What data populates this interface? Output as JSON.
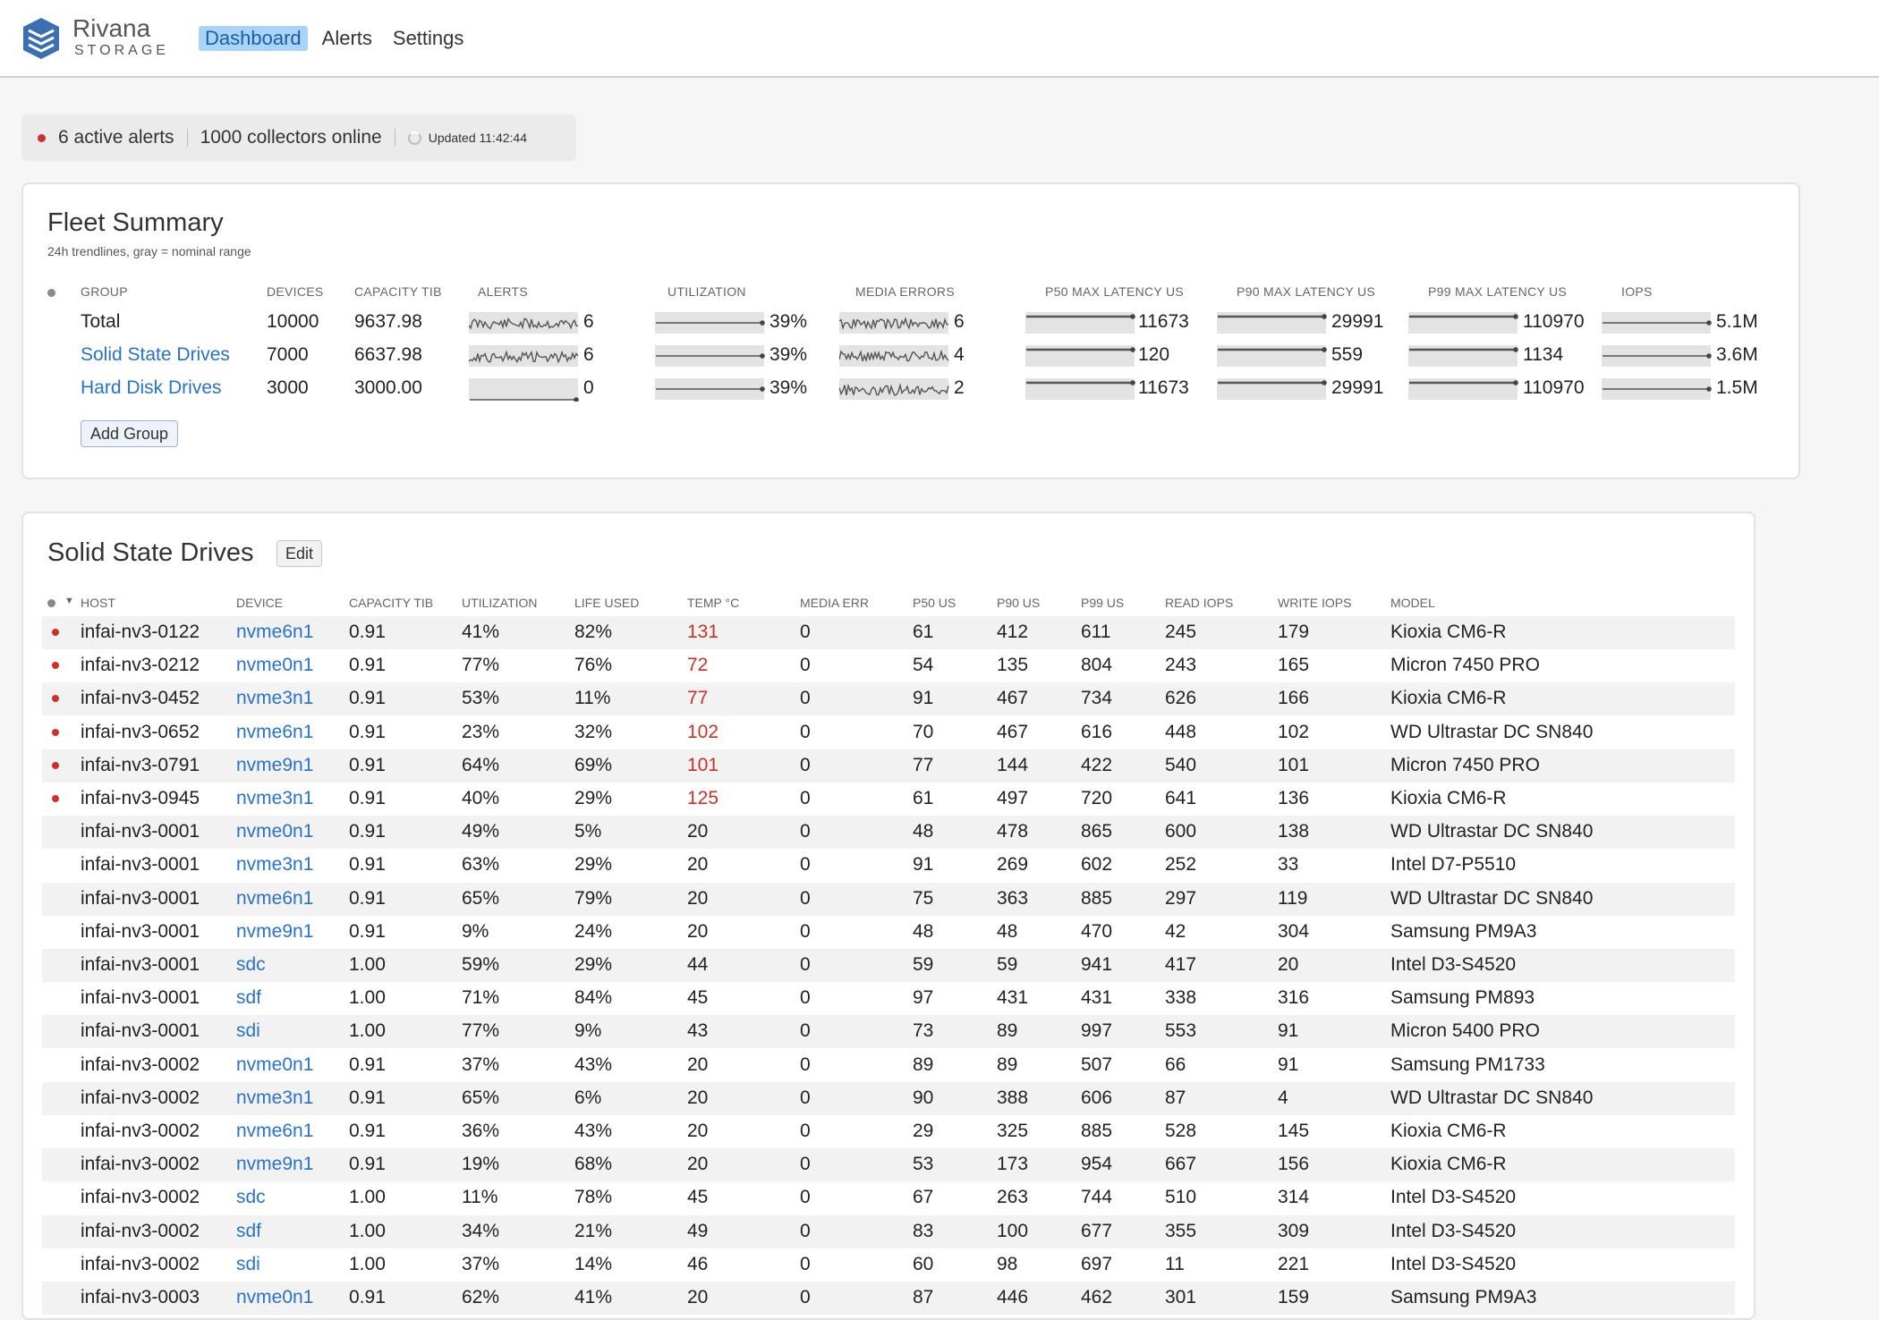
{
  "brand": {
    "name": "Rivana",
    "sub": "STORAGE"
  },
  "nav": [
    {
      "label": "Dashboard",
      "active": true
    },
    {
      "label": "Alerts"
    },
    {
      "label": "Settings"
    }
  ],
  "status": {
    "alerts": "6 active alerts",
    "collectors": "1000 collectors online",
    "updated": "Updated 11:42:44"
  },
  "fleet": {
    "title": "Fleet Summary",
    "subtitle": "24h trendlines, gray = nominal range",
    "headers": [
      "GROUP",
      "DEVICES",
      "CAPACITY TIB",
      "ALERTS",
      "UTILIZATION",
      "MEDIA ERRORS",
      "P50 MAX LATENCY US",
      "P90 MAX LATENCY US",
      "P99 MAX LATENCY US",
      "IOPS"
    ],
    "rows": [
      {
        "group": "Total",
        "devices": "10000",
        "capacity": "9637.98",
        "alerts": "6",
        "util": "39%",
        "media": "6",
        "p50": "11673",
        "p90": "29991",
        "p99": "110970",
        "iops": "5.1M",
        "link": false,
        "alerts_flat": false
      },
      {
        "group": "Solid State Drives",
        "devices": "7000",
        "capacity": "6637.98",
        "alerts": "6",
        "util": "39%",
        "media": "4",
        "p50": "120",
        "p90": "559",
        "p99": "1134",
        "iops": "3.6M",
        "link": true,
        "alerts_flat": false
      },
      {
        "group": "Hard Disk Drives",
        "devices": "3000",
        "capacity": "3000.00",
        "alerts": "0",
        "util": "39%",
        "media": "2",
        "p50": "11673",
        "p90": "29991",
        "p99": "110970",
        "iops": "1.5M",
        "link": true,
        "alerts_flat": true
      }
    ],
    "add_group": "Add Group"
  },
  "ssd": {
    "title": "Solid State Drives",
    "edit": "Edit",
    "headers": [
      "HOST",
      "DEVICE",
      "CAPACITY TIB",
      "UTILIZATION",
      "LIFE USED",
      "TEMP °C",
      "MEDIA ERR",
      "P50 US",
      "P90 US",
      "P99 US",
      "READ IOPS",
      "WRITE IOPS",
      "MODEL"
    ],
    "rows": [
      {
        "alert": true,
        "host": "infai-nv3-0122",
        "device": "nvme6n1",
        "cap": "0.91",
        "util": "41%",
        "life": "82%",
        "temp": "131",
        "hot": true,
        "merr": "0",
        "p50": "61",
        "p90": "412",
        "p99": "611",
        "riops": "245",
        "wiops": "179",
        "model": "Kioxia CM6-R"
      },
      {
        "alert": true,
        "host": "infai-nv3-0212",
        "device": "nvme0n1",
        "cap": "0.91",
        "util": "77%",
        "life": "76%",
        "temp": "72",
        "hot": true,
        "merr": "0",
        "p50": "54",
        "p90": "135",
        "p99": "804",
        "riops": "243",
        "wiops": "165",
        "model": "Micron 7450 PRO"
      },
      {
        "alert": true,
        "host": "infai-nv3-0452",
        "device": "nvme3n1",
        "cap": "0.91",
        "util": "53%",
        "life": "11%",
        "temp": "77",
        "hot": true,
        "merr": "0",
        "p50": "91",
        "p90": "467",
        "p99": "734",
        "riops": "626",
        "wiops": "166",
        "model": "Kioxia CM6-R"
      },
      {
        "alert": true,
        "host": "infai-nv3-0652",
        "device": "nvme6n1",
        "cap": "0.91",
        "util": "23%",
        "life": "32%",
        "temp": "102",
        "hot": true,
        "merr": "0",
        "p50": "70",
        "p90": "467",
        "p99": "616",
        "riops": "448",
        "wiops": "102",
        "model": "WD Ultrastar DC SN840"
      },
      {
        "alert": true,
        "host": "infai-nv3-0791",
        "device": "nvme9n1",
        "cap": "0.91",
        "util": "64%",
        "life": "69%",
        "temp": "101",
        "hot": true,
        "merr": "0",
        "p50": "77",
        "p90": "144",
        "p99": "422",
        "riops": "540",
        "wiops": "101",
        "model": "Micron 7450 PRO"
      },
      {
        "alert": true,
        "host": "infai-nv3-0945",
        "device": "nvme3n1",
        "cap": "0.91",
        "util": "40%",
        "life": "29%",
        "temp": "125",
        "hot": true,
        "merr": "0",
        "p50": "61",
        "p90": "497",
        "p99": "720",
        "riops": "641",
        "wiops": "136",
        "model": "Kioxia CM6-R"
      },
      {
        "alert": false,
        "host": "infai-nv3-0001",
        "device": "nvme0n1",
        "cap": "0.91",
        "util": "49%",
        "life": "5%",
        "temp": "20",
        "hot": false,
        "merr": "0",
        "p50": "48",
        "p90": "478",
        "p99": "865",
        "riops": "600",
        "wiops": "138",
        "model": "WD Ultrastar DC SN840"
      },
      {
        "alert": false,
        "host": "infai-nv3-0001",
        "device": "nvme3n1",
        "cap": "0.91",
        "util": "63%",
        "life": "29%",
        "temp": "20",
        "hot": false,
        "merr": "0",
        "p50": "91",
        "p90": "269",
        "p99": "602",
        "riops": "252",
        "wiops": "33",
        "model": "Intel D7-P5510"
      },
      {
        "alert": false,
        "host": "infai-nv3-0001",
        "device": "nvme6n1",
        "cap": "0.91",
        "util": "65%",
        "life": "79%",
        "temp": "20",
        "hot": false,
        "merr": "0",
        "p50": "75",
        "p90": "363",
        "p99": "885",
        "riops": "297",
        "wiops": "119",
        "model": "WD Ultrastar DC SN840"
      },
      {
        "alert": false,
        "host": "infai-nv3-0001",
        "device": "nvme9n1",
        "cap": "0.91",
        "util": "9%",
        "life": "24%",
        "temp": "20",
        "hot": false,
        "merr": "0",
        "p50": "48",
        "p90": "48",
        "p99": "470",
        "riops": "42",
        "wiops": "304",
        "model": "Samsung PM9A3"
      },
      {
        "alert": false,
        "host": "infai-nv3-0001",
        "device": "sdc",
        "cap": "1.00",
        "util": "59%",
        "life": "29%",
        "temp": "44",
        "hot": false,
        "merr": "0",
        "p50": "59",
        "p90": "59",
        "p99": "941",
        "riops": "417",
        "wiops": "20",
        "model": "Intel D3-S4520"
      },
      {
        "alert": false,
        "host": "infai-nv3-0001",
        "device": "sdf",
        "cap": "1.00",
        "util": "71%",
        "life": "84%",
        "temp": "45",
        "hot": false,
        "merr": "0",
        "p50": "97",
        "p90": "431",
        "p99": "431",
        "riops": "338",
        "wiops": "316",
        "model": "Samsung PM893"
      },
      {
        "alert": false,
        "host": "infai-nv3-0001",
        "device": "sdi",
        "cap": "1.00",
        "util": "77%",
        "life": "9%",
        "temp": "43",
        "hot": false,
        "merr": "0",
        "p50": "73",
        "p90": "89",
        "p99": "997",
        "riops": "553",
        "wiops": "91",
        "model": "Micron 5400 PRO"
      },
      {
        "alert": false,
        "host": "infai-nv3-0002",
        "device": "nvme0n1",
        "cap": "0.91",
        "util": "37%",
        "life": "43%",
        "temp": "20",
        "hot": false,
        "merr": "0",
        "p50": "89",
        "p90": "89",
        "p99": "507",
        "riops": "66",
        "wiops": "91",
        "model": "Samsung PM1733"
      },
      {
        "alert": false,
        "host": "infai-nv3-0002",
        "device": "nvme3n1",
        "cap": "0.91",
        "util": "65%",
        "life": "6%",
        "temp": "20",
        "hot": false,
        "merr": "0",
        "p50": "90",
        "p90": "388",
        "p99": "606",
        "riops": "87",
        "wiops": "4",
        "model": "WD Ultrastar DC SN840"
      },
      {
        "alert": false,
        "host": "infai-nv3-0002",
        "device": "nvme6n1",
        "cap": "0.91",
        "util": "36%",
        "life": "43%",
        "temp": "20",
        "hot": false,
        "merr": "0",
        "p50": "29",
        "p90": "325",
        "p99": "885",
        "riops": "528",
        "wiops": "145",
        "model": "Kioxia CM6-R"
      },
      {
        "alert": false,
        "host": "infai-nv3-0002",
        "device": "nvme9n1",
        "cap": "0.91",
        "util": "19%",
        "life": "68%",
        "temp": "20",
        "hot": false,
        "merr": "0",
        "p50": "53",
        "p90": "173",
        "p99": "954",
        "riops": "667",
        "wiops": "156",
        "model": "Kioxia CM6-R"
      },
      {
        "alert": false,
        "host": "infai-nv3-0002",
        "device": "sdc",
        "cap": "1.00",
        "util": "11%",
        "life": "78%",
        "temp": "45",
        "hot": false,
        "merr": "0",
        "p50": "67",
        "p90": "263",
        "p99": "744",
        "riops": "510",
        "wiops": "314",
        "model": "Intel D3-S4520"
      },
      {
        "alert": false,
        "host": "infai-nv3-0002",
        "device": "sdf",
        "cap": "1.00",
        "util": "34%",
        "life": "21%",
        "temp": "49",
        "hot": false,
        "merr": "0",
        "p50": "83",
        "p90": "100",
        "p99": "677",
        "riops": "355",
        "wiops": "309",
        "model": "Intel D3-S4520"
      },
      {
        "alert": false,
        "host": "infai-nv3-0002",
        "device": "sdi",
        "cap": "1.00",
        "util": "37%",
        "life": "14%",
        "temp": "46",
        "hot": false,
        "merr": "0",
        "p50": "60",
        "p90": "98",
        "p99": "697",
        "riops": "11",
        "wiops": "221",
        "model": "Intel D3-S4520"
      },
      {
        "alert": false,
        "host": "infai-nv3-0003",
        "device": "nvme0n1",
        "cap": "0.91",
        "util": "62%",
        "life": "41%",
        "temp": "20",
        "hot": false,
        "merr": "0",
        "p50": "87",
        "p90": "446",
        "p99": "462",
        "riops": "301",
        "wiops": "159",
        "model": "Samsung PM9A3"
      }
    ]
  },
  "colors": {
    "accent": "#2a72c9",
    "alert": "#d0302a",
    "nav_active_bg": "#a9d4f7"
  }
}
